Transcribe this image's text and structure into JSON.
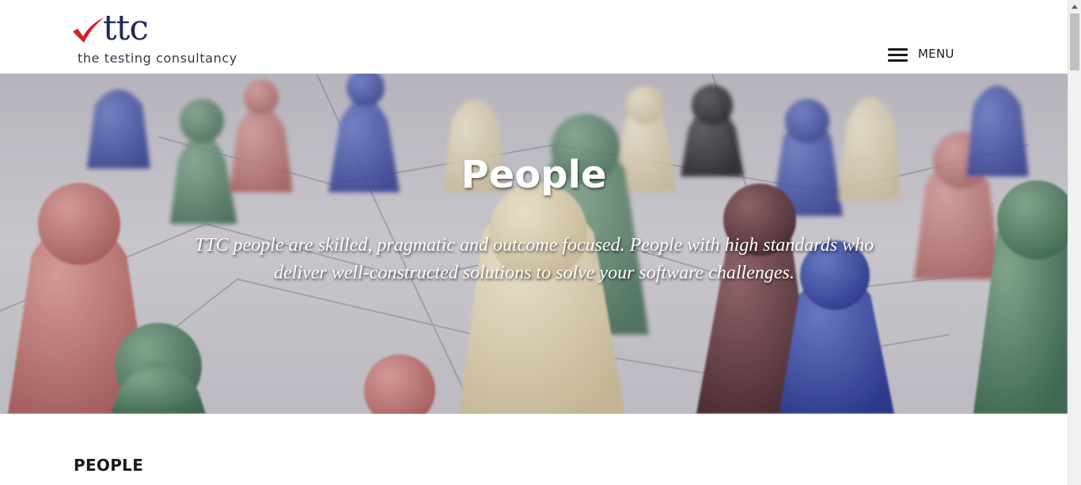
{
  "brand": {
    "logo_text": "ttc",
    "tagline": "the testing consultancy",
    "check_color": "#d0222a",
    "text_color": "#1f2a5a"
  },
  "header": {
    "menu_label": "MENU",
    "menu_icon": "hamburger-icon"
  },
  "hero": {
    "title": "People",
    "text": "TTC people are skilled, pragmatic and outcome focused. People with high standards who deliver well-constructed solutions to solve your software challenges."
  },
  "main": {
    "section_heading": "PEOPLE"
  }
}
